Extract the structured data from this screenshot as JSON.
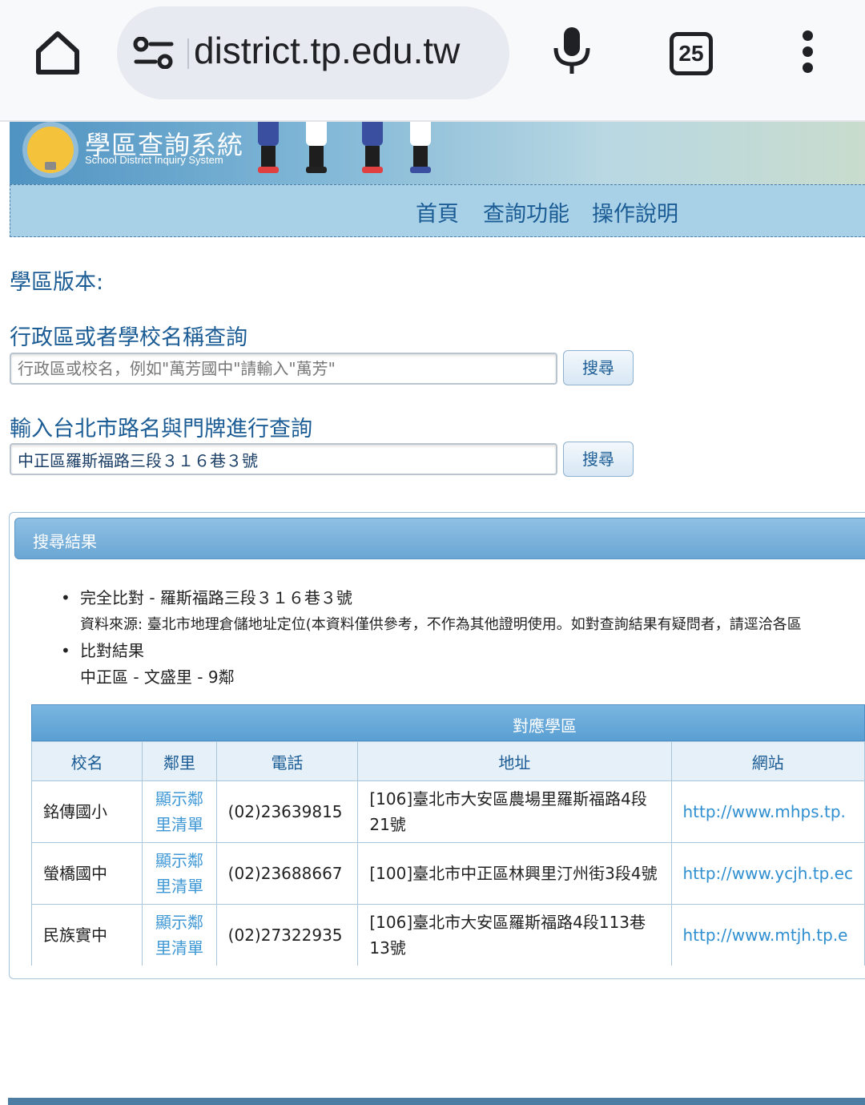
{
  "browser": {
    "url": "district.tp.edu.tw",
    "tab_count": "25"
  },
  "site": {
    "title": "學區查詢系統",
    "subtitle": "School District Inquiry System",
    "nav": [
      "首頁",
      "查詢功能",
      "操作說明"
    ]
  },
  "form": {
    "version_label": "學區版本:",
    "school_search": {
      "label": "行政區或者學校名稱查詢",
      "placeholder": "行政區或校名，例如\"萬芳國中\"請輸入\"萬芳\"",
      "button": "搜尋"
    },
    "address_search": {
      "label": "輸入台北市路名與門牌進行查詢",
      "value": "中正區羅斯福路三段３１６巷３號",
      "button": "搜尋"
    }
  },
  "results": {
    "title": "搜尋結果",
    "match_line": "完全比對 - 羅斯福路三段３１６巷３號",
    "source_line": "資料來源: 臺北市地理倉儲地址定位(本資料僅供參考，不作為其他證明使用。如對查詢結果有疑問者，請逕洽各區",
    "compare_label": "比對結果",
    "compare_value": "中正區 - 文盛里 - 9鄰",
    "table": {
      "caption": "對應學區",
      "headers": [
        "校名",
        "鄰里",
        "電話",
        "地址",
        "網站"
      ],
      "rows": [
        {
          "name": "銘傳國小",
          "nb": "顯示鄰里清單",
          "phone": "(02)23639815",
          "addr": "[106]臺北市大安區農場里羅斯福路4段21號",
          "site": "http://www.mhps.tp."
        },
        {
          "name": "螢橋國中",
          "nb": "顯示鄰里清單",
          "phone": "(02)23688667",
          "addr": "[100]臺北市中正區林興里汀州街3段4號",
          "site": "http://www.ycjh.tp.ec"
        },
        {
          "name": "民族實中",
          "nb": "顯示鄰里清單",
          "phone": "(02)27322935",
          "addr": "[106]臺北市大安區羅斯福路4段113巷13號",
          "site": "http://www.mtjh.tp.e"
        }
      ]
    }
  }
}
